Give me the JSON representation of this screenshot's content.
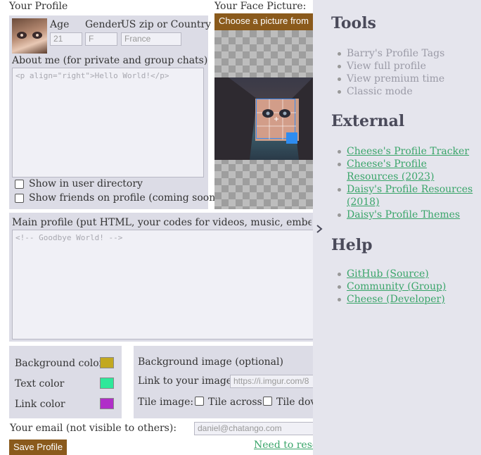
{
  "profile": {
    "section_title": "Your Profile",
    "age_label": "Age",
    "gender_label": "Gender",
    "zip_label": "US zip or Country",
    "age_value": "21",
    "gender_value": "F",
    "country_value": "France",
    "about_label": "About me (for private and group chats)",
    "about_value": "<p align=\"right\">Hello World!</p>",
    "show_directory_label": "Show in user directory",
    "show_friends_label": "Show friends on profile (coming soon)"
  },
  "face": {
    "section_title": "Your Face Picture:",
    "choose_button": "Choose a picture from"
  },
  "main_profile": {
    "label": "Main profile (put HTML, your codes for videos, music, embeds etc",
    "value": "<!-- Goodbye World! -->"
  },
  "colors": {
    "background_label": "Background color",
    "background_hex": "#c2a820",
    "text_label": "Text color",
    "text_hex": "#2ee89a",
    "link_label": "Link color",
    "link_hex": "#b02ec8"
  },
  "bg_image": {
    "title": "Background image (optional)",
    "link_label": "Link to your image:",
    "link_placeholder": "https://i.imgur.com/8",
    "tile_label": "Tile image:",
    "tile_across_label": "Tile across",
    "tile_down_label": "Tile dov"
  },
  "email": {
    "label": "Your email (not visible to others):",
    "value": "daniel@chatango.com"
  },
  "footer": {
    "save_button": "Save Profile",
    "reset_link": "Need to reset"
  },
  "sidebar": {
    "collapse_icon": "chevron-right-icon",
    "tools_title": "Tools",
    "tools": [
      "Barry's Profile Tags",
      "View full profile",
      "View premium time",
      "Classic mode"
    ],
    "external_title": "External",
    "external": [
      "Cheese's Profile Tracker",
      "Cheese's Profile Resources (2023)",
      "Daisy's Profile Resources (2018)",
      "Daisy's Profile Themes"
    ],
    "help_title": "Help",
    "help": [
      "GitHub (Source)",
      "Community (Group)",
      "Cheese (Developer)"
    ],
    "link_color": "#3aa56a"
  }
}
